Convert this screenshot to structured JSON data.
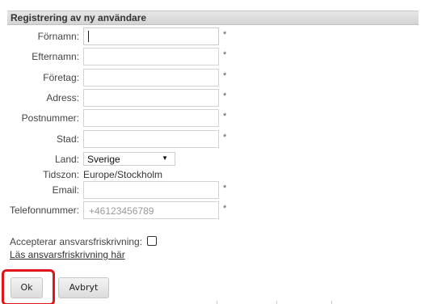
{
  "form": {
    "title": "Registrering av ny användare",
    "required_mark": "*",
    "fields": {
      "firstname": {
        "label": "Förnamn:",
        "value": ""
      },
      "lastname": {
        "label": "Efternamn:",
        "value": ""
      },
      "company": {
        "label": "Företag:",
        "value": ""
      },
      "address": {
        "label": "Adress:",
        "value": ""
      },
      "postcode": {
        "label": "Postnummer:",
        "value": ""
      },
      "city": {
        "label": "Stad:",
        "value": ""
      },
      "country": {
        "label": "Land:",
        "selected": "Sverige"
      },
      "timezone": {
        "label": "Tidszon:",
        "value": "Europe/Stockholm"
      },
      "email": {
        "label": "Email:",
        "value": ""
      },
      "phone": {
        "label": "Telefonnummer:",
        "placeholder": "+46123456789"
      }
    },
    "disclaimer": {
      "label": "Accepterar ansvarsfriskrivning:",
      "checked": false,
      "link_text": "Läs ansvarsfriskrivning här"
    },
    "buttons": {
      "ok": "Ok",
      "cancel": "Avbryt"
    }
  },
  "colors": {
    "highlight": "#e0141b",
    "header_bg": "#dcdcdc"
  },
  "icons": {
    "select_arrow": "chevron-down-icon"
  }
}
